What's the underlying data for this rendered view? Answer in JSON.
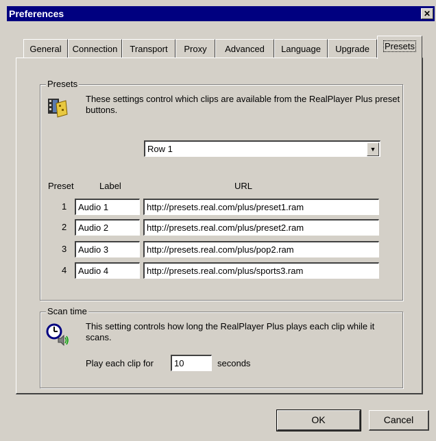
{
  "window": {
    "title": "Preferences",
    "close_label": "✕"
  },
  "tabs": [
    {
      "label": "General"
    },
    {
      "label": "Connection"
    },
    {
      "label": "Transport"
    },
    {
      "label": "Proxy"
    },
    {
      "label": "Advanced"
    },
    {
      "label": "Language"
    },
    {
      "label": "Upgrade"
    },
    {
      "label": "Presets",
      "active": true
    }
  ],
  "presets": {
    "group_title": "Presets",
    "description": "These settings control which clips are available from the RealPlayer Plus preset buttons.",
    "row_select": {
      "value": "Row 1"
    },
    "headers": {
      "preset": "Preset",
      "label": "Label",
      "url": "URL"
    },
    "rows": [
      {
        "num": "1",
        "label": "Audio 1",
        "url": "http://presets.real.com/plus/preset1.ram"
      },
      {
        "num": "2",
        "label": "Audio 2",
        "url": "http://presets.real.com/plus/preset2.ram"
      },
      {
        "num": "3",
        "label": "Audio 3",
        "url": "http://presets.real.com/plus/pop2.ram"
      },
      {
        "num": "4",
        "label": "Audio 4",
        "url": "http://presets.real.com/plus/sports3.ram"
      }
    ]
  },
  "scan_time": {
    "group_title": "Scan time",
    "description": "This setting controls how long the RealPlayer Plus plays each clip while it scans.",
    "play_label": "Play each clip for",
    "seconds_value": "10",
    "seconds_label": "seconds"
  },
  "buttons": {
    "ok": "OK",
    "cancel": "Cancel"
  },
  "colors": {
    "title_bar": "#000080",
    "face": "#d4d0c8"
  }
}
